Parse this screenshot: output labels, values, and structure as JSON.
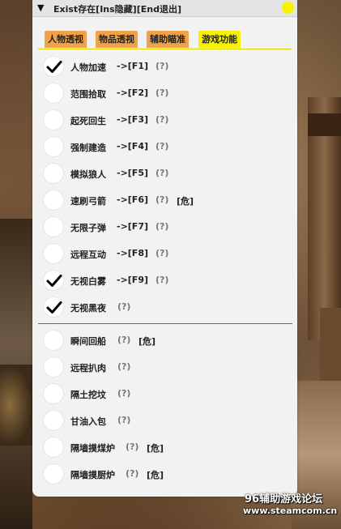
{
  "window": {
    "collapse_glyph": "▼",
    "title": "Exist存在[Ins隐藏][End退出]",
    "indicator_color": "#f7f200"
  },
  "tabs": [
    {
      "label": "人物透视",
      "active": false
    },
    {
      "label": "物品透视",
      "active": false
    },
    {
      "label": "辅助瞄准",
      "active": false
    },
    {
      "label": "游戏功能",
      "active": true
    }
  ],
  "colors": {
    "tab": "#f0a24a",
    "tab_active": "#f7f200",
    "checked_mark": "#000000"
  },
  "features": [
    {
      "label": "人物加速",
      "hotkey": "->[F1]",
      "help": "(?)",
      "checked": true
    },
    {
      "label": "范围拾取",
      "hotkey": "->[F2]",
      "help": "(?)",
      "checked": false
    },
    {
      "label": "起死回生",
      "hotkey": "->[F3]",
      "help": "(?)",
      "checked": false
    },
    {
      "label": "强制建造",
      "hotkey": "->[F4]",
      "help": "(?)",
      "checked": false
    },
    {
      "label": "模拟狼人",
      "hotkey": "->[F5]",
      "help": "(?)",
      "checked": false
    },
    {
      "label": "速刷弓箭",
      "hotkey": "->[F6]",
      "help": "(?)",
      "warn": "[危]",
      "checked": false
    },
    {
      "label": "无限子弹",
      "hotkey": "->[F7]",
      "help": "(?)",
      "checked": false
    },
    {
      "label": "远程互动",
      "hotkey": "->[F8]",
      "help": "(?)",
      "checked": false
    },
    {
      "label": "无视白雾",
      "hotkey": "->[F9]",
      "help": "(?)",
      "checked": true
    },
    {
      "label": "无视黑夜",
      "help": "(?)",
      "checked": true
    }
  ],
  "extras": [
    {
      "label": "瞬间回船",
      "help": "(?)",
      "warn": "[危]",
      "checked": false
    },
    {
      "label": "远程扒肉",
      "help": "(?)",
      "checked": false
    },
    {
      "label": "隔土挖坟",
      "help": "(?)",
      "checked": false
    },
    {
      "label": "甘油入包",
      "help": "(?)",
      "checked": false
    },
    {
      "label": "隔墙摸煤炉",
      "help": "(?)",
      "warn": "[危]",
      "checked": false
    },
    {
      "label": "隔墙摸厨炉",
      "help": "(?)",
      "warn": "[危]",
      "checked": false
    }
  ],
  "watermark": {
    "line1": "96辅助游戏论坛",
    "line2": "www.steamcom.cn"
  }
}
